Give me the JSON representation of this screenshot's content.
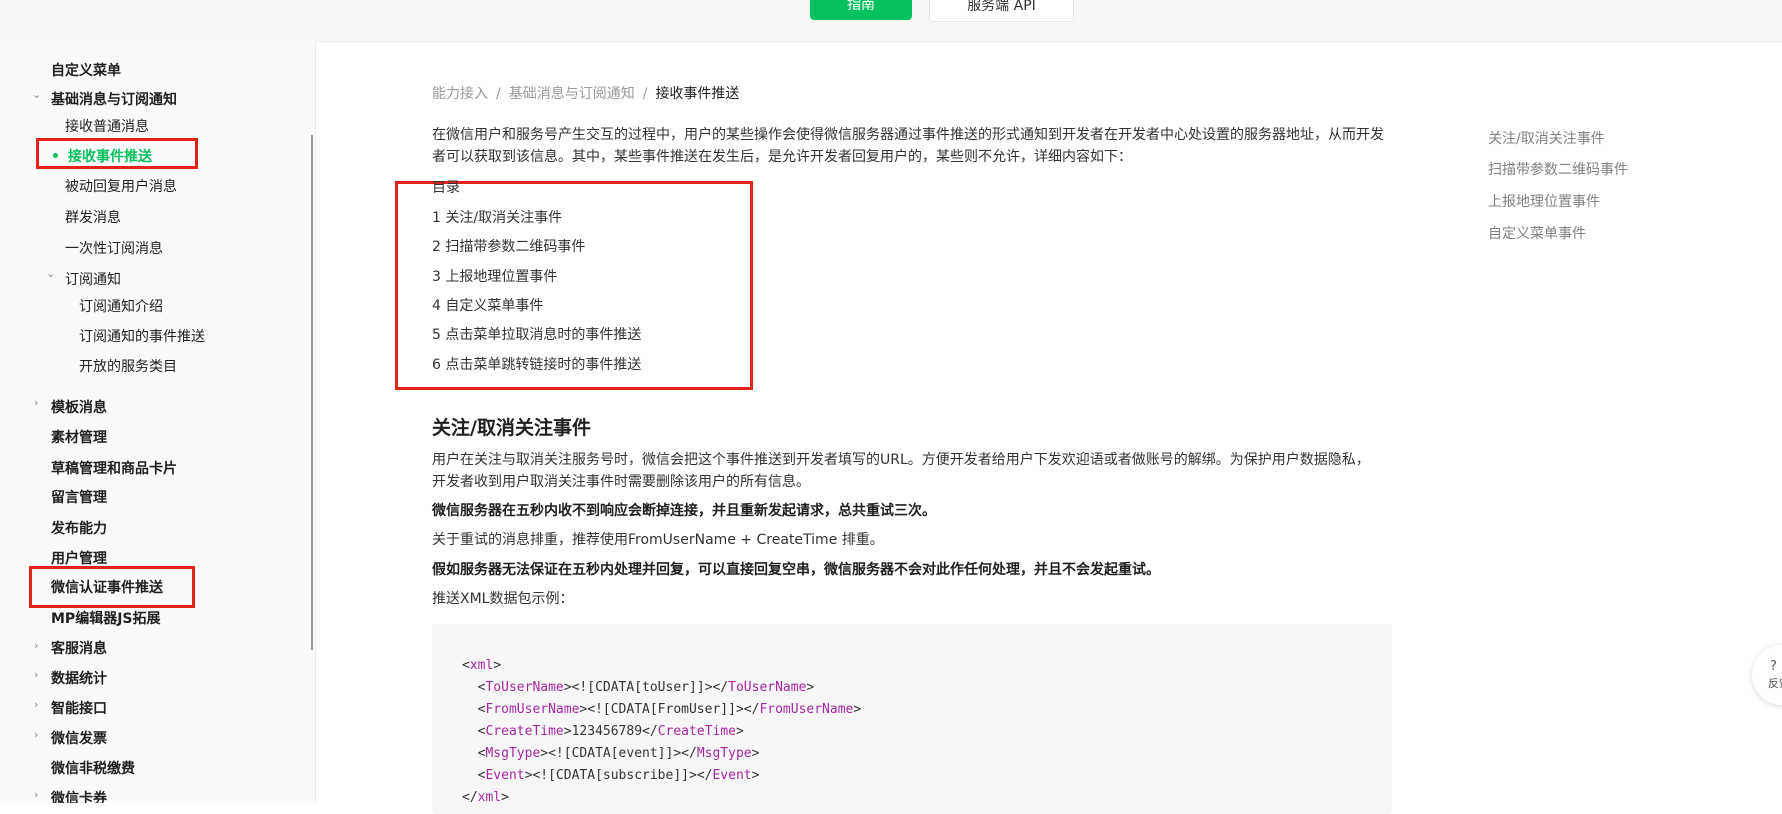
{
  "topbar": {
    "primary_button": "指南",
    "secondary_button": "服务端 API"
  },
  "sidebar": {
    "items": [
      {
        "label": "自定义菜单"
      },
      {
        "label": "基础消息与订阅通知"
      },
      {
        "label": "接收普通消息"
      },
      {
        "label": "接收事件推送"
      },
      {
        "label": "被动回复用户消息"
      },
      {
        "label": "群发消息"
      },
      {
        "label": "一次性订阅消息"
      },
      {
        "label": "订阅通知"
      },
      {
        "label": "订阅通知介绍"
      },
      {
        "label": "订阅通知的事件推送"
      },
      {
        "label": "开放的服务类目"
      },
      {
        "label": "模板消息"
      },
      {
        "label": "素材管理"
      },
      {
        "label": "草稿管理和商品卡片"
      },
      {
        "label": "留言管理"
      },
      {
        "label": "发布能力"
      },
      {
        "label": "用户管理"
      },
      {
        "label": "微信认证事件推送"
      },
      {
        "label": "MP编辑器JS拓展"
      },
      {
        "label": "客服消息"
      },
      {
        "label": "数据统计"
      },
      {
        "label": "智能接口"
      },
      {
        "label": "微信发票"
      },
      {
        "label": "微信非税缴费"
      },
      {
        "label": "微信卡券"
      }
    ]
  },
  "breadcrumb": {
    "items": [
      "能力接入",
      "基础消息与订阅通知",
      "接收事件推送"
    ],
    "separator": "/"
  },
  "content": {
    "intro_line1": "在微信用户和服务号产生交互的过程中，用户的某些操作会使得微信服务器通过事件推送的形式通知到开发者在开发者中心处设置的服务器地址，从而开发",
    "intro_line2": "者可以获取到该信息。其中，某些事件推送在发生后，是允许开发者回复用户的，某些则不允许，详细内容如下：",
    "toc_title": "目录",
    "toc": [
      "1 关注/取消关注事件",
      "2 扫描带参数二维码事件",
      "3 上报地理位置事件",
      "4 自定义菜单事件",
      "5 点击菜单拉取消息时的事件推送",
      "6 点击菜单跳转链接时的事件推送"
    ],
    "section_title": "关注/取消关注事件",
    "p1_line1": "用户在关注与取消关注服务号时，微信会把这个事件推送到开发者填写的URL。方便开发者给用户下发欢迎语或者做账号的解绑。为保护用户数据隐私，",
    "p1_line2": "开发者收到用户取消关注事件时需要删除该用户的所有信息。",
    "p2": "微信服务器在五秒内收不到响应会断掉连接，并且重新发起请求，总共重试三次。",
    "p3": "关于重试的消息排重，推荐使用FromUserName + CreateTime 排重。",
    "p4": "假如服务器无法保证在五秒内处理并回复，可以直接回复空串，微信服务器不会对此作任何处理，并且不会发起重试。",
    "p5": "推送XML数据包示例："
  },
  "code": {
    "lines": [
      {
        "open": "<",
        "tag": "xml",
        "mid": "",
        "close_tag": "",
        "end": ">"
      },
      {
        "indent": "  ",
        "tag": "ToUserName",
        "value": "<![CDATA[toUser]]>"
      },
      {
        "indent": "  ",
        "tag": "FromUserName",
        "value": "<![CDATA[FromUser]]>"
      },
      {
        "indent": "  ",
        "tag": "CreateTime",
        "value": "123456789"
      },
      {
        "indent": "  ",
        "tag": "MsgType",
        "value": "<![CDATA[event]]>"
      },
      {
        "indent": "  ",
        "tag": "Event",
        "value": "<![CDATA[subscribe]]>"
      },
      {
        "open": "</",
        "tag": "xml",
        "end": ">"
      }
    ]
  },
  "right_toc": {
    "items": [
      "关注/取消关注事件",
      "扫描带参数二维码事件",
      "上报地理位置事件",
      "自定义菜单事件"
    ]
  },
  "help": {
    "icon": "question-icon",
    "label": "反馈",
    "question_mark": "?"
  },
  "colors": {
    "accent": "#07c160",
    "highlight_box": "#e3231b",
    "code_tag": "#a626a4"
  }
}
